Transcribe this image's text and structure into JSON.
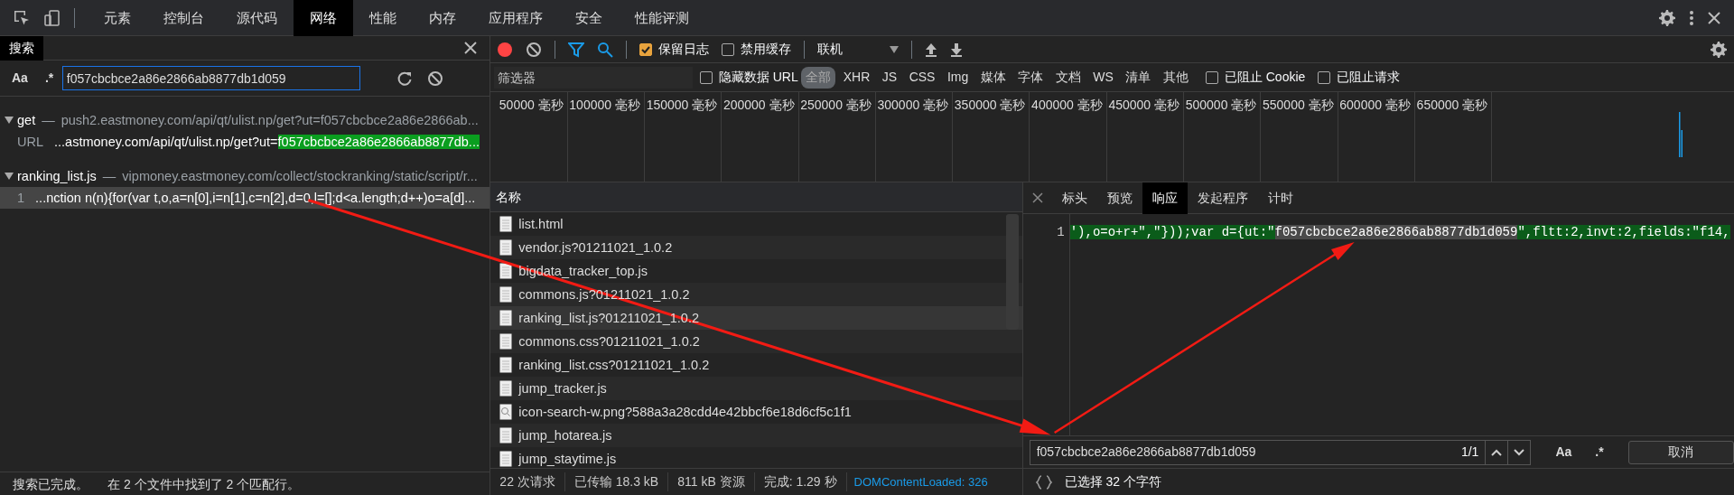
{
  "main_tabs": [
    {
      "label": "元素",
      "selected": false
    },
    {
      "label": "控制台",
      "selected": false
    },
    {
      "label": "源代码",
      "selected": false
    },
    {
      "label": "网络",
      "selected": true
    },
    {
      "label": "性能",
      "selected": false
    },
    {
      "label": "内存",
      "selected": false
    },
    {
      "label": "应用程序",
      "selected": false
    },
    {
      "label": "安全",
      "selected": false
    },
    {
      "label": "性能评测",
      "selected": false
    }
  ],
  "search_panel": {
    "title": "搜索",
    "case_button": "Aa",
    "regex_button": ".*",
    "query": "f057cbcbce2a86e2866ab8877db1d059",
    "results": [
      {
        "file": "get",
        "separator": "—",
        "url": "push2.eastmoney.com/api/qt/ulist.np/get?ut=f057cbcbce2a86e2866ab...",
        "expanded": true,
        "matches": [
          {
            "line": "URL",
            "before": "...astmoney.com/api/qt/ulist.np/get?ut=",
            "match": "f057cbcbce2a86e2866ab8877db...",
            "selected": false
          }
        ]
      },
      {
        "file": "ranking_list.js",
        "separator": "—",
        "url": "vipmoney.eastmoney.com/collect/stockranking/static/script/r...",
        "expanded": true,
        "matches": [
          {
            "line": "1",
            "before": "...nction n(n){for(var t,o,a=n[0],i=n[1],c=n[2],d=0,l=[];d<a.length;d++)o=a[d]...",
            "selected": true
          }
        ]
      }
    ],
    "status": [
      "搜索已完成。",
      "在 2 个文件中找到了 2 个匹配行。"
    ]
  },
  "toolbar": {
    "recording": true,
    "preserve_log": {
      "label": "保留日志",
      "checked": true
    },
    "disable_cache": {
      "label": "禁用缓存",
      "checked": false
    },
    "throttling": "联机"
  },
  "filter_bar": {
    "placeholder": "筛选器",
    "hide_data_urls": {
      "label": "隐藏数据 URL",
      "checked": false
    },
    "types": [
      {
        "label": "全部",
        "selected": true
      },
      {
        "label": "XHR",
        "selected": false
      },
      {
        "label": "JS",
        "selected": false
      },
      {
        "label": "CSS",
        "selected": false
      },
      {
        "label": "Img",
        "selected": false
      },
      {
        "label": "媒体",
        "selected": false
      },
      {
        "label": "字体",
        "selected": false
      },
      {
        "label": "文档",
        "selected": false
      },
      {
        "label": "WS",
        "selected": false
      },
      {
        "label": "清单",
        "selected": false
      },
      {
        "label": "其他",
        "selected": false
      }
    ],
    "blocked_cookies": {
      "label": "已阻止 Cookie",
      "checked": false
    },
    "blocked_requests": {
      "label": "已阻止请求",
      "checked": false
    }
  },
  "overview_ticks": [
    "50000 毫秒",
    "100000 毫秒",
    "150000 毫秒",
    "200000 毫秒",
    "250000 毫秒",
    "300000 毫秒",
    "350000 毫秒",
    "400000 毫秒",
    "450000 毫秒",
    "500000 毫秒",
    "550000 毫秒",
    "600000 毫秒",
    "650000 毫秒"
  ],
  "requests": {
    "column": "名称",
    "rows": [
      {
        "name": "list.html",
        "kind": "document",
        "selected": false
      },
      {
        "name": "vendor.js?01211021_1.0.2",
        "kind": "document",
        "selected": false
      },
      {
        "name": "bigdata_tracker_top.js",
        "kind": "document",
        "selected": false
      },
      {
        "name": "commons.js?01211021_1.0.2",
        "kind": "document",
        "selected": false
      },
      {
        "name": "ranking_list.js?01211021_1.0.2",
        "kind": "document",
        "selected": true
      },
      {
        "name": "commons.css?01211021_1.0.2",
        "kind": "document",
        "selected": false
      },
      {
        "name": "ranking_list.css?01211021_1.0.2",
        "kind": "document",
        "selected": false
      },
      {
        "name": "jump_tracker.js",
        "kind": "document",
        "selected": false
      },
      {
        "name": "icon-search-w.png?588a3a28cdd4e42bbcf6e18d6cf5c1f1",
        "kind": "image",
        "selected": false
      },
      {
        "name": "jump_hotarea.js",
        "kind": "document",
        "selected": false
      },
      {
        "name": "jump_staytime.js",
        "kind": "document",
        "selected": false
      }
    ],
    "summary": [
      "22 次请求",
      "已传输 18.3 kB",
      "811 kB 资源",
      "完成: 1.29 秒"
    ],
    "dom_content_loaded": "DOMContentLoaded: 326"
  },
  "details": {
    "tabs": [
      {
        "label": "标头",
        "selected": false
      },
      {
        "label": "预览",
        "selected": false
      },
      {
        "label": "响应",
        "selected": true
      },
      {
        "label": "发起程序",
        "selected": false
      },
      {
        "label": "计时",
        "selected": false
      }
    ],
    "code": {
      "line_number": "1",
      "before": "'),o=o+r+\",\"}));var d={ut:\"",
      "match": "f057cbcbce2a86e2866ab8877db1d059",
      "after": "\",fltt:2,invt:2,fields:\"f14,"
    },
    "find": {
      "value": "f057cbcbce2a86e2866ab8877db1d059",
      "count": "1/1",
      "case_button": "Aa",
      "regex_button": ".*",
      "cancel": "取消"
    },
    "status": "已选择 32 个字符"
  }
}
